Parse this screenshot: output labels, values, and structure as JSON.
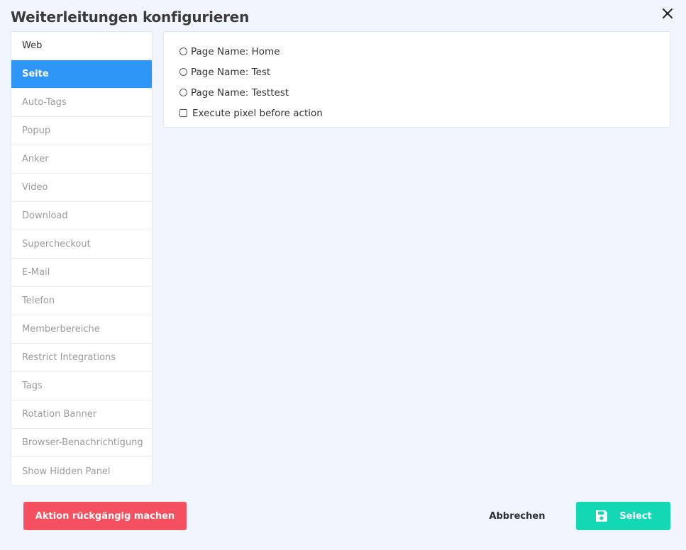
{
  "modal": {
    "title": "Weiterleitungen konfigurieren",
    "close_icon": "close-icon"
  },
  "sidebar": {
    "active_index": 1,
    "items": [
      {
        "label": "Web"
      },
      {
        "label": "Seite"
      },
      {
        "label": "Auto-Tags"
      },
      {
        "label": "Popup"
      },
      {
        "label": "Anker"
      },
      {
        "label": "Video"
      },
      {
        "label": "Download"
      },
      {
        "label": "Supercheckout"
      },
      {
        "label": "E-Mail"
      },
      {
        "label": "Telefon"
      },
      {
        "label": "Memberbereiche"
      },
      {
        "label": "Restrict Integrations"
      },
      {
        "label": "Tags"
      },
      {
        "label": "Rotation Banner"
      },
      {
        "label": "Browser-Benachrichtigung"
      },
      {
        "label": "Show Hidden Panel"
      }
    ]
  },
  "content": {
    "pages": [
      {
        "label": "Page Name: Home",
        "selected": false
      },
      {
        "label": "Page Name: Test",
        "selected": false
      },
      {
        "label": "Page Name: Testtest",
        "selected": false
      }
    ],
    "execute_pixel": {
      "label": "Execute pixel before action",
      "checked": false
    }
  },
  "footer": {
    "undo_label": "Aktion rückgängig machen",
    "cancel_label": "Abbrechen",
    "select_label": "Select",
    "select_icon": "save-icon"
  },
  "colors": {
    "active_tab": "#2e96f7",
    "undo_button": "#f5505f",
    "select_button": "#14d7b3",
    "background": "#f1f5fd"
  }
}
